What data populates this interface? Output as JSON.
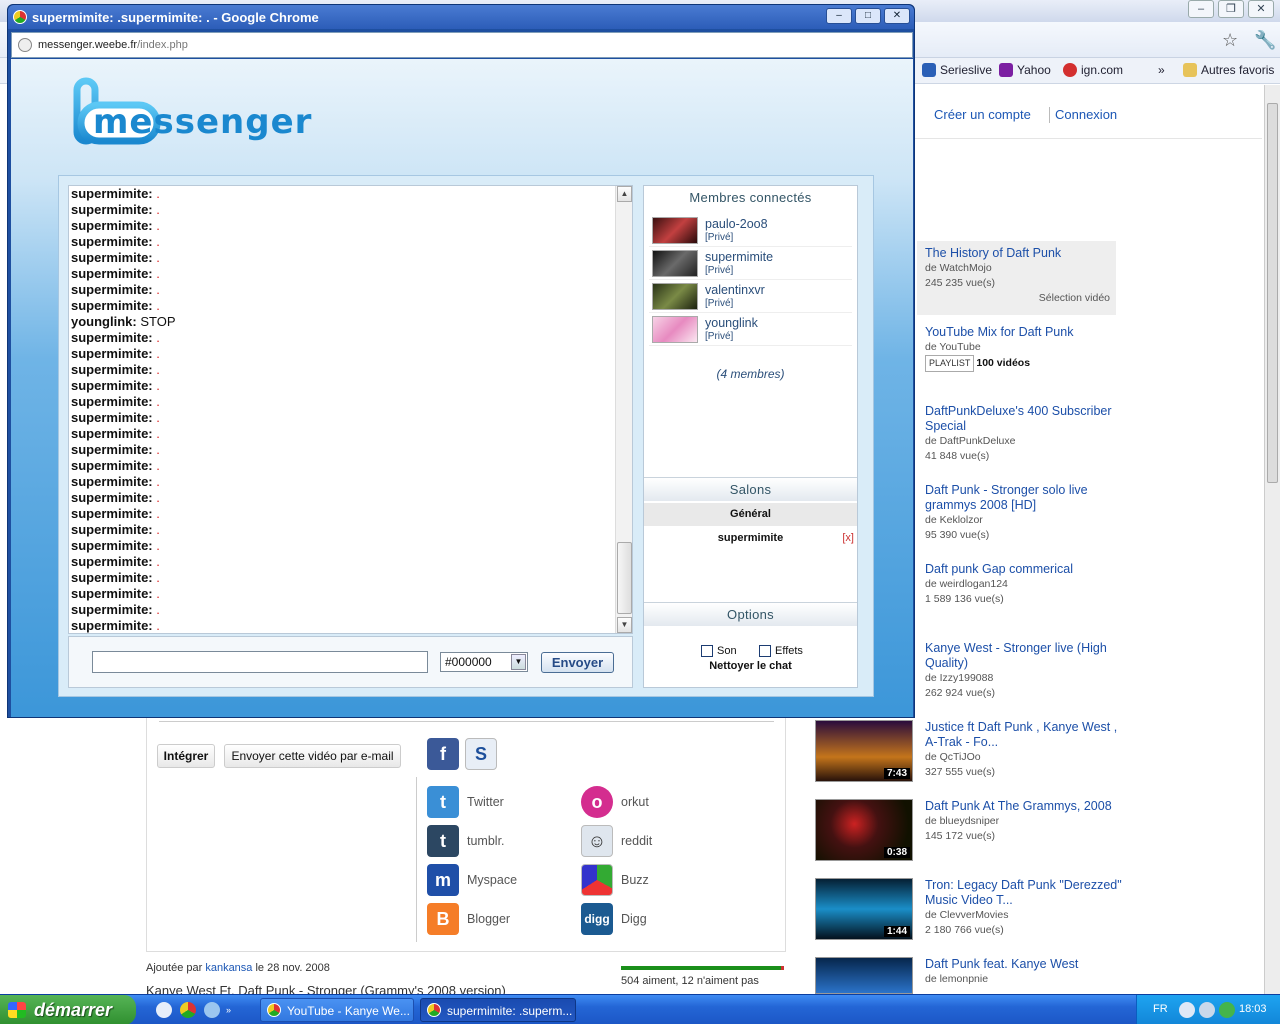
{
  "background_window": {
    "bookmarks": [
      "Serieslive",
      "Yahoo",
      "ign.com",
      "»",
      "Autres favoris"
    ],
    "top_links": [
      "Créer un compte",
      "Connexion"
    ],
    "related": [
      {
        "title": "The History of Daft Punk",
        "by": "de WatchMojo",
        "views": "245 235 vue(s)",
        "extra": "Sélection vidéo"
      },
      {
        "title": "YouTube Mix for Daft Punk",
        "by": "de YouTube",
        "playlist": "PLAYLIST",
        "count": "100 vidéos"
      },
      {
        "title": "DaftPunkDeluxe's 400 Subscriber Special",
        "by": "de DaftPunkDeluxe",
        "views": "41 848 vue(s)"
      },
      {
        "title": "Daft Punk - Stronger solo live grammys 2008 [HD]",
        "by": "de Keklolzor",
        "views": "95 390 vue(s)"
      },
      {
        "title": "Daft punk Gap commerical",
        "by": "de weirdlogan124",
        "views": "1 589 136 vue(s)"
      },
      {
        "title": "Kanye West - Stronger live (High Quality)",
        "by": "de Izzy199088",
        "views": "262 924 vue(s)"
      },
      {
        "title": "Justice ft Daft Punk , Kanye West , A-Trak - Fo...",
        "by": "de QcTiJOo",
        "views": "327 555 vue(s)",
        "duration": "7:43"
      },
      {
        "title": "Daft Punk At The Grammys, 2008",
        "by": "de blueydsniper",
        "views": "145 172 vue(s)",
        "duration": "0:38"
      },
      {
        "title": "Tron: Legacy Daft Punk \"Derezzed\" Music Video T...",
        "by": "de ClevverMovies",
        "views": "2 180 766 vue(s)",
        "duration": "1:44"
      },
      {
        "title": "Daft Punk feat. Kanye West",
        "by": "de lemonpnie"
      }
    ],
    "share": {
      "embed": "Intégrer",
      "email": "Envoyer cette vidéo par e-mail",
      "services": [
        {
          "name": "Twitter",
          "color": "#3a8fd6",
          "glyph": "t"
        },
        {
          "name": "orkut",
          "color": "#d42d8f",
          "glyph": "o"
        },
        {
          "name": "tumblr.",
          "color": "#2c4762",
          "glyph": "t"
        },
        {
          "name": "reddit",
          "color": "#dfe6ee",
          "glyph": "r"
        },
        {
          "name": "Myspace",
          "color": "#1f4fa8",
          "glyph": "m"
        },
        {
          "name": "Buzz",
          "color": "#e9e9e9",
          "glyph": "b"
        },
        {
          "name": "Blogger",
          "color": "#f57d28",
          "glyph": "B"
        },
        {
          "name": "Digg",
          "color": "#1b5a91",
          "glyph": "digg"
        }
      ]
    },
    "added_prefix": "Ajoutée par",
    "added_user": "kankansa",
    "added_suffix": "le 28 nov. 2008",
    "video_title": "Kanye West Ft. Daft Punk - Stronger (Grammy's 2008 version)",
    "likes": "504 aiment, 12 n'aiment pas"
  },
  "popup": {
    "title": "supermimite: .supermimite: . - Google Chrome",
    "url_host": "messenger.weebe.fr",
    "url_path": "/index.php",
    "logo_text": "messenger",
    "messages": [
      {
        "user": "supermimite:",
        "text": ".",
        "dot": true
      },
      {
        "user": "supermimite:",
        "text": ".",
        "dot": true
      },
      {
        "user": "supermimite:",
        "text": ".",
        "dot": true
      },
      {
        "user": "supermimite:",
        "text": ".",
        "dot": true
      },
      {
        "user": "supermimite:",
        "text": ".",
        "dot": true
      },
      {
        "user": "supermimite:",
        "text": ".",
        "dot": true
      },
      {
        "user": "supermimite:",
        "text": ".",
        "dot": true
      },
      {
        "user": "supermimite:",
        "text": ".",
        "dot": true
      },
      {
        "user": "younglink:",
        "text": "STOP",
        "dot": false
      },
      {
        "user": "supermimite:",
        "text": ".",
        "dot": true
      },
      {
        "user": "supermimite:",
        "text": ".",
        "dot": true
      },
      {
        "user": "supermimite:",
        "text": ".",
        "dot": true
      },
      {
        "user": "supermimite:",
        "text": ".",
        "dot": true
      },
      {
        "user": "supermimite:",
        "text": ".",
        "dot": true
      },
      {
        "user": "supermimite:",
        "text": ".",
        "dot": true
      },
      {
        "user": "supermimite:",
        "text": ".",
        "dot": true
      },
      {
        "user": "supermimite:",
        "text": ".",
        "dot": true
      },
      {
        "user": "supermimite:",
        "text": ".",
        "dot": true
      },
      {
        "user": "supermimite:",
        "text": ".",
        "dot": true
      },
      {
        "user": "supermimite:",
        "text": ".",
        "dot": true
      },
      {
        "user": "supermimite:",
        "text": ".",
        "dot": true
      },
      {
        "user": "supermimite:",
        "text": ".",
        "dot": true
      },
      {
        "user": "supermimite:",
        "text": ".",
        "dot": true
      },
      {
        "user": "supermimite:",
        "text": ".",
        "dot": true
      },
      {
        "user": "supermimite:",
        "text": ".",
        "dot": true
      },
      {
        "user": "supermimite:",
        "text": ".",
        "dot": true
      },
      {
        "user": "supermimite:",
        "text": ".",
        "dot": true
      },
      {
        "user": "supermimite:",
        "text": ".",
        "dot": true
      }
    ],
    "color_value": "#000000",
    "send_label": "Envoyer",
    "members_header": "Membres connectés",
    "members": [
      {
        "name": "paulo-2oo8",
        "tag": "[Privé]",
        "avatar_color": "#8a2d2d"
      },
      {
        "name": "supermimite",
        "tag": "[Privé]",
        "avatar_color": "#3a3a3a"
      },
      {
        "name": "valentinxvr",
        "tag": "[Privé]",
        "avatar_color": "#4b5a2e"
      },
      {
        "name": "younglink",
        "tag": "[Privé]",
        "avatar_color": "#e9a5c9"
      }
    ],
    "member_count": "(4 membres)",
    "rooms_header": "Salons",
    "rooms": [
      {
        "name": "Général",
        "close": ""
      },
      {
        "name": "supermimite",
        "close": "[x]"
      }
    ],
    "options_header": "Options",
    "option_son": "Son",
    "option_effets": "Effets",
    "clean_label": "Nettoyer le chat"
  },
  "taskbar": {
    "start_label": "démarrer",
    "tasks": [
      "YouTube - Kanye We...",
      "supermimite: .superm..."
    ],
    "lang": "FR",
    "clock": "18:03"
  },
  "colors": {
    "xp_blue": "#2466d6",
    "youtube_link": "#1c4fa8",
    "popup_gradient_bottom": "#3d97d9"
  }
}
